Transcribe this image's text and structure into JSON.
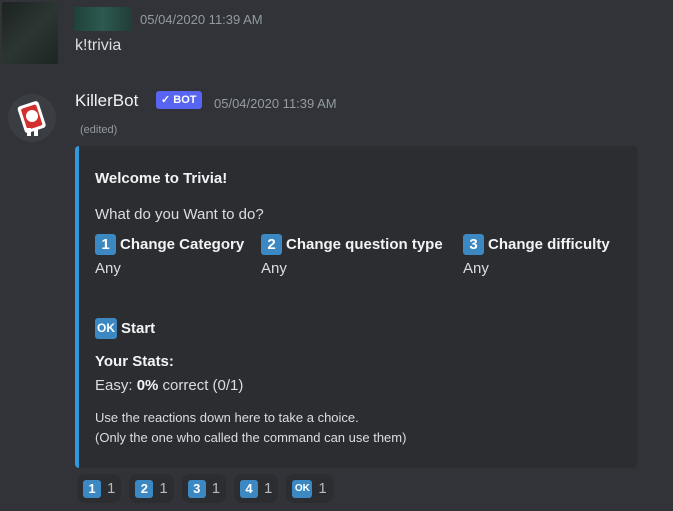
{
  "message1": {
    "timestamp": "05/04/2020 11:39 AM",
    "text": "k!trivia"
  },
  "message2": {
    "author": "KillerBot",
    "bot_badge": "BOT",
    "timestamp": "05/04/2020 11:39 AM",
    "edited": "(edited)",
    "embed": {
      "accent_color": "#3498db",
      "title": "Welcome to Trivia!",
      "question": "What do you Want to do?",
      "fields": [
        {
          "key": "1",
          "name": "Change Category",
          "value": "Any"
        },
        {
          "key": "2",
          "name": "Change question type",
          "value": "Any"
        },
        {
          "key": "3",
          "name": "Change difficulty",
          "value": "Any"
        }
      ],
      "start_key": "OK",
      "start_label": "Start",
      "stats_heading": "Your Stats:",
      "stats_prefix": "Easy: ",
      "stats_percent": "0%",
      "stats_suffix": " correct (0/1)",
      "footer_line1": "Use the reactions down here to take a choice.",
      "footer_line2": "(Only the one who called the command can use them)"
    },
    "reactions": [
      {
        "emoji": "1",
        "count": "1"
      },
      {
        "emoji": "2",
        "count": "1"
      },
      {
        "emoji": "3",
        "count": "1"
      },
      {
        "emoji": "4",
        "count": "1"
      },
      {
        "emoji": "OK",
        "count": "1"
      }
    ]
  }
}
